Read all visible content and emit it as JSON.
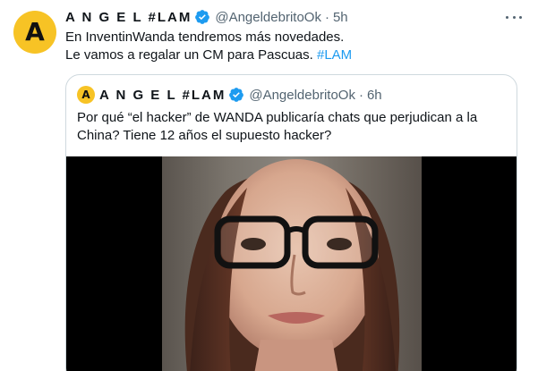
{
  "tweet": {
    "author_name": "A N G E L #LAM",
    "author_handle": "@AngeldebritoOk",
    "separator": "·",
    "time": "5h",
    "avatar_letter": "A",
    "text_line1": "En InventinWanda tendremos más novedades.",
    "text_line2_prefix": "Le vamos a regalar un CM para Pascuas. ",
    "hashtag": "#LAM"
  },
  "quote": {
    "author_name": "A N G E L #LAM",
    "author_handle": "@AngeldebritoOk",
    "separator": "·",
    "time": "6h",
    "avatar_letter": "A",
    "text": "Por qué “el hacker” de WANDA publicaría chats que perjudican a la China? Tiene 12 años el supuesto hacker?"
  },
  "colors": {
    "accent": "#1d9bf0",
    "avatar_bg": "#f7c325",
    "secondary_text": "#536471",
    "border": "#cfd9de"
  },
  "icons": {
    "verified": "verified-badge-icon",
    "more": "more-options-icon"
  }
}
